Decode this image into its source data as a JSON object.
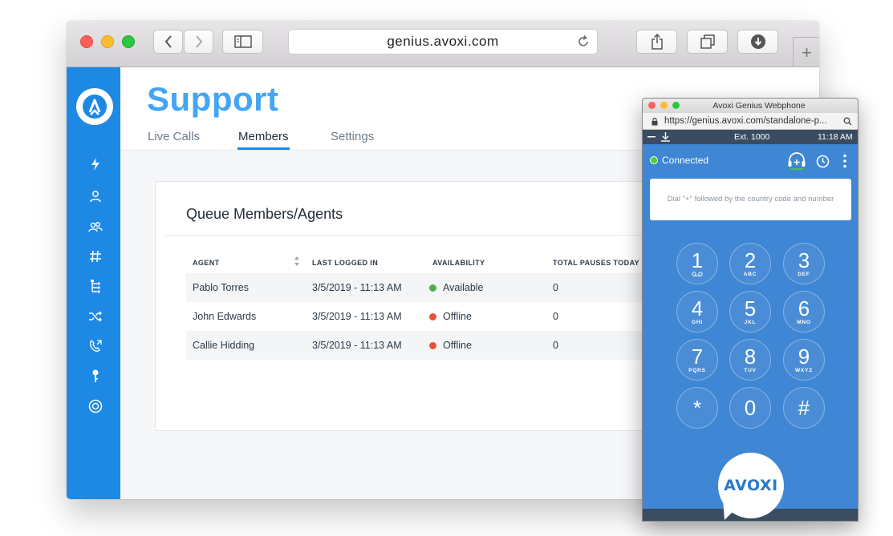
{
  "browser": {
    "url": "genius.avoxi.com",
    "new_tab_symbol": "+"
  },
  "sidebar": {
    "items": [
      {
        "icon": "lightning-icon"
      },
      {
        "icon": "user-icon"
      },
      {
        "icon": "users-icon"
      },
      {
        "icon": "hash-icon"
      },
      {
        "icon": "tree-icon"
      },
      {
        "icon": "shuffle-icon"
      },
      {
        "icon": "phone-forward-icon"
      },
      {
        "icon": "key-icon"
      },
      {
        "icon": "support-ring-icon"
      }
    ]
  },
  "page": {
    "title": "Support",
    "tabs": [
      {
        "label": "Live Calls",
        "active": false
      },
      {
        "label": "Members",
        "active": true
      },
      {
        "label": "Settings",
        "active": false
      }
    ]
  },
  "card": {
    "title": "Queue Members/Agents",
    "columns": [
      "AGENT",
      "LAST LOGGED IN",
      "AVAILABILITY",
      "TOTAL PAUSES TODAY"
    ],
    "rows": [
      {
        "agent": "Pablo Torres",
        "last_logged_in": "3/5/2019 - 11:13 AM",
        "availability": "Available",
        "status_color": "#4caf50",
        "pauses": "0"
      },
      {
        "agent": "John Edwards",
        "last_logged_in": "3/5/2019 - 11:13 AM",
        "availability": "Offline",
        "status_color": "#e8533b",
        "pauses": "0"
      },
      {
        "agent": "Callie Hidding",
        "last_logged_in": "3/5/2019 - 11:13 AM",
        "availability": "Offline",
        "status_color": "#e8533b",
        "pauses": "0"
      }
    ]
  },
  "webphone": {
    "window_title": "Avoxi Genius Webphone",
    "url": "https://genius.avoxi.com/standalone-p...",
    "extension": "Ext. 1000",
    "time": "11:18 AM",
    "status": "Connected",
    "dial_placeholder": "Dial \"+\" followed by the country code and number",
    "keys": [
      {
        "num": "1",
        "letters": ""
      },
      {
        "num": "2",
        "letters": "ABC"
      },
      {
        "num": "3",
        "letters": "DEF"
      },
      {
        "num": "4",
        "letters": "GHI"
      },
      {
        "num": "5",
        "letters": "JKL"
      },
      {
        "num": "6",
        "letters": "MNO"
      },
      {
        "num": "7",
        "letters": "PQRS"
      },
      {
        "num": "8",
        "letters": "TUV"
      },
      {
        "num": "9",
        "letters": "WXYZ"
      },
      {
        "num": "*",
        "letters": ""
      },
      {
        "num": "0",
        "letters": ""
      },
      {
        "num": "#",
        "letters": ""
      }
    ],
    "brand": "AVOXI"
  },
  "colors": {
    "accent": "#1e88e5",
    "title": "#42a5f5",
    "phone_bg": "#3f86d4",
    "available": "#4caf50",
    "offline": "#e8533b"
  }
}
